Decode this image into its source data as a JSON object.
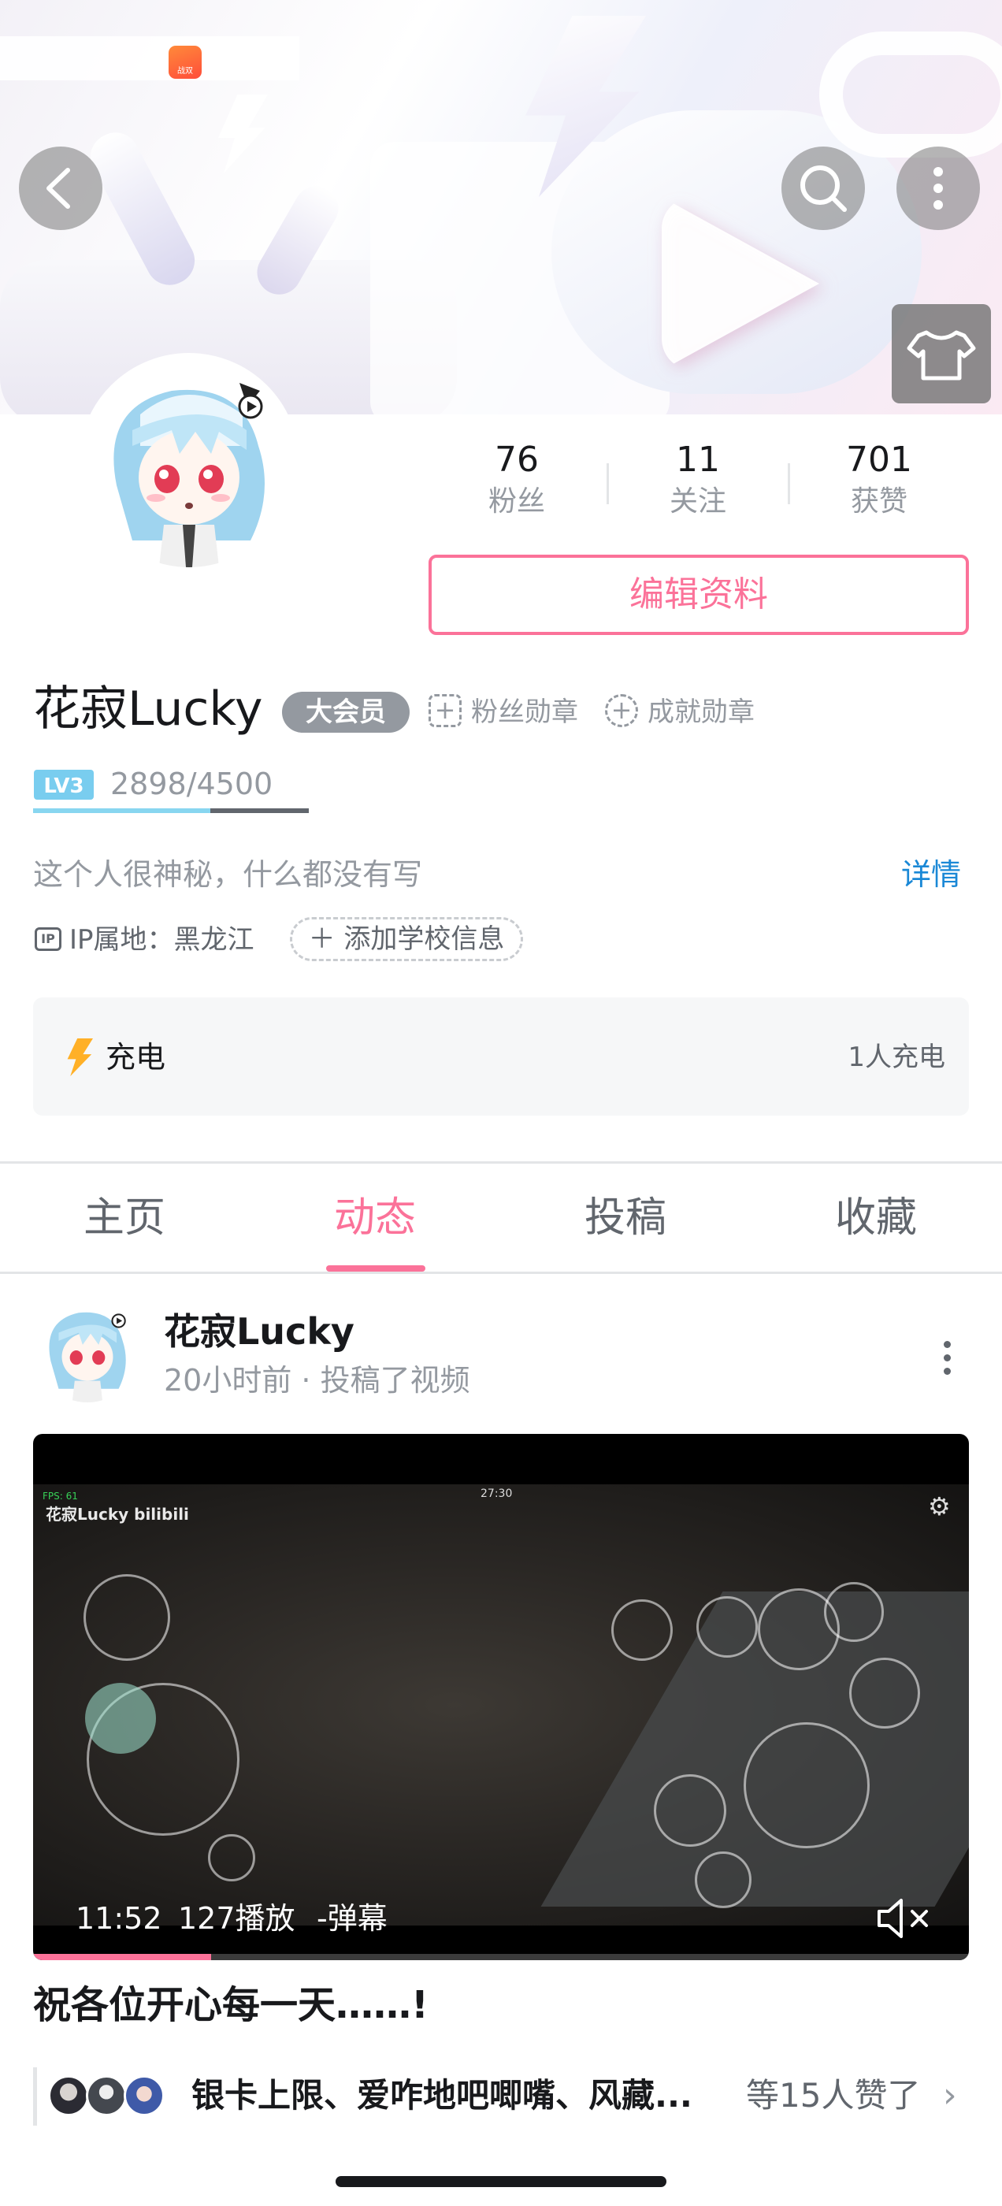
{
  "header": {
    "back_icon": "chevron-left-icon",
    "search_icon": "search-icon",
    "more_icon": "more-vertical-icon",
    "skin_icon": "tshirt-icon",
    "app_badge_text": "战双"
  },
  "stats": [
    {
      "value": "76",
      "label": "粉丝"
    },
    {
      "value": "11",
      "label": "关注"
    },
    {
      "value": "701",
      "label": "获赞"
    }
  ],
  "profile": {
    "edit_label": "编辑资料",
    "username": "花寂Lucky",
    "vip_label": "大会员",
    "fan_medal_label": "粉丝勋章",
    "achievement_label": "成就勋章",
    "level": "LV3",
    "exp_text": "2898/4500",
    "exp_current": 2898,
    "exp_max": 4500,
    "bio": "这个人很神秘，什么都没有写",
    "detail_link": "详情",
    "ip_badge": "IP",
    "ip_location": "IP属地：黑龙江",
    "add_school": "添加学校信息",
    "charge_label": "充电",
    "charge_count": "1人充电"
  },
  "tabs": [
    {
      "label": "主页",
      "active": false
    },
    {
      "label": "动态",
      "active": true
    },
    {
      "label": "投稿",
      "active": false
    },
    {
      "label": "收藏",
      "active": false
    }
  ],
  "post": {
    "author": "花寂Lucky",
    "meta": "20小时前 · 投稿了视频",
    "video": {
      "watermark": "花寂Lucky bilibili",
      "fps_text": "FPS: 61",
      "timer_text": "27:30",
      "duration": "11:52",
      "plays": "127播放",
      "danmaku": "-弹幕",
      "progress": 0.19
    },
    "text": "祝各位开心每一天……!",
    "likers": "银卡上限、爱咋地吧唧嘴、风藏...",
    "likes_count": "等15人赞了"
  },
  "colors": {
    "accent": "#fb7299",
    "link": "#1a88d6",
    "muted": "#9499a0",
    "charge": "#ffb027"
  }
}
